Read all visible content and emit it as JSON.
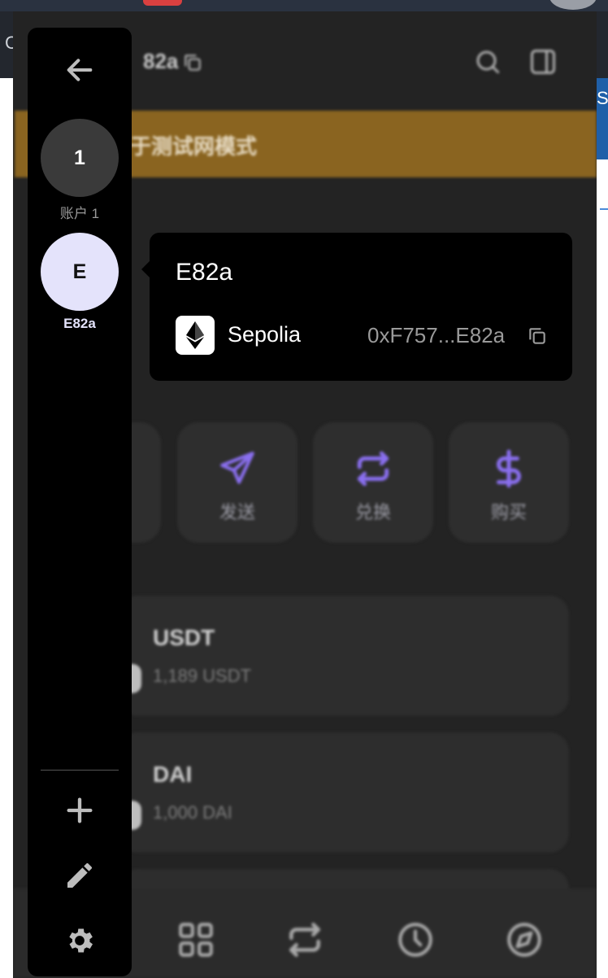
{
  "browser": {
    "left_edge_text": "C",
    "right_edge_text": "Se"
  },
  "header": {
    "account_suffix": "82a",
    "search_icon": "search-icon",
    "panel_icon": "sidepanel-icon"
  },
  "banner": {
    "text": "于测试网模式",
    "color": "#8a6420"
  },
  "actions": [
    {
      "label": "发送",
      "icon": "send-icon"
    },
    {
      "label": "兑换",
      "icon": "swap-icon"
    },
    {
      "label": "购买",
      "icon": "dollar-icon"
    }
  ],
  "assets": [
    {
      "name": "USDT",
      "amount": "1,189 USDT"
    },
    {
      "name": "DAI",
      "amount": "1,000 DAI"
    }
  ],
  "bottom_nav": [
    {
      "icon": "grid-icon"
    },
    {
      "icon": "swap-icon"
    },
    {
      "icon": "clock-icon"
    },
    {
      "icon": "compass-icon"
    }
  ],
  "sidebar": {
    "back_icon": "arrow-left-icon",
    "accounts": [
      {
        "initial": "1",
        "label": "账户 1"
      },
      {
        "initial": "E",
        "label": "E82a"
      }
    ],
    "footer_icons": [
      "plus-icon",
      "pencil-icon",
      "gear-icon"
    ]
  },
  "tooltip": {
    "title": "E82a",
    "network": "Sepolia",
    "address": "0xF757...E82a"
  },
  "colors": {
    "accent": "#8a6ff0",
    "selected_account": "#e4e3fb",
    "background": "#232323"
  }
}
